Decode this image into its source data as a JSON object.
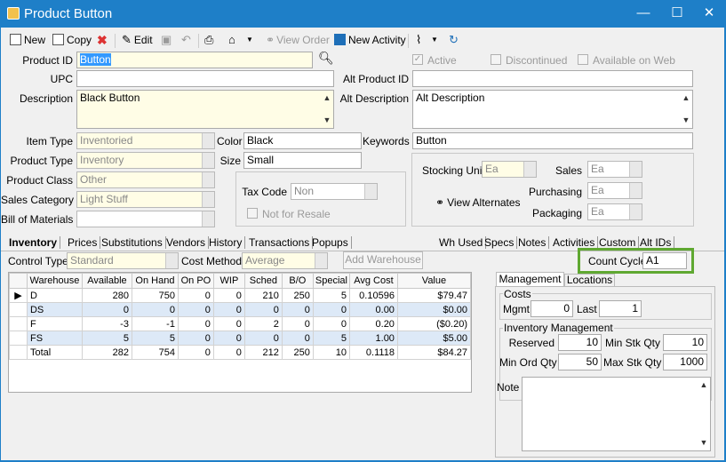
{
  "window": {
    "title": "Product Button",
    "minimize": "—",
    "maximize": "☐",
    "close": "✕"
  },
  "toolbar": {
    "new": "New",
    "copy": "Copy",
    "edit": "Edit",
    "view_order": "View Order",
    "new_activity": "New Activity"
  },
  "form": {
    "product_id_label": "Product ID",
    "product_id": "Button",
    "upc_label": "UPC",
    "upc": "",
    "description_label": "Description",
    "description": "Black Button",
    "alt_product_id_label": "Alt Product ID",
    "alt_product_id": "",
    "alt_description_label": "Alt Description",
    "alt_description": "Alt Description",
    "active_label": "Active",
    "discontinued_label": "Discontinued",
    "available_on_web_label": "Available on Web",
    "item_type_label": "Item Type",
    "item_type": "Inventoried",
    "product_type_label": "Product Type",
    "product_type": "Inventory",
    "product_class_label": "Product Class",
    "product_class": "Other",
    "sales_category_label": "Sales Category",
    "sales_category": "Light Stuff",
    "bill_of_materials_label": "Bill of Materials",
    "bill_of_materials": "",
    "color_label": "Color",
    "color": "Black",
    "size_label": "Size",
    "size": "Small",
    "keywords_label": "Keywords",
    "keywords": "Button",
    "tax_code_label": "Tax Code",
    "tax_code": "Non",
    "not_for_resale_label": "Not for Resale",
    "stocking_unit_label": "Stocking Unit",
    "stocking_unit": "Ea",
    "view_alternates": "View Alternates",
    "sales_label": "Sales",
    "sales_unit": "Ea",
    "purchasing_label": "Purchasing",
    "purchasing_unit": "Ea",
    "packaging_label": "Packaging",
    "packaging_unit": "Ea"
  },
  "tabs_left": [
    "Inventory",
    "Prices",
    "Substitutions",
    "Vendors",
    "History",
    "Transactions",
    "Popups"
  ],
  "tabs_right": [
    "Wh Used",
    "Specs",
    "Notes",
    "Activities",
    "Custom",
    "Alt IDs"
  ],
  "inventory": {
    "control_type_label": "Control Type",
    "control_type": "Standard",
    "cost_method_label": "Cost Method",
    "cost_method": "Average",
    "add_warehouse": "Add Warehouse",
    "count_cycle_label": "Count Cycle",
    "count_cycle": "A1",
    "columns": [
      "Warehouse",
      "Available",
      "On Hand",
      "On PO",
      "WIP",
      "Sched",
      "B/O",
      "Special",
      "Avg Cost",
      "Value"
    ],
    "rows": [
      [
        "D",
        "280",
        "750",
        "0",
        "0",
        "210",
        "250",
        "5",
        "0.10596",
        "$79.47"
      ],
      [
        "DS",
        "0",
        "0",
        "0",
        "0",
        "0",
        "0",
        "0",
        "0.00",
        "$0.00"
      ],
      [
        "F",
        "-3",
        "-1",
        "0",
        "0",
        "2",
        "0",
        "0",
        "0.20",
        "($0.20)"
      ],
      [
        "FS",
        "5",
        "5",
        "0",
        "0",
        "0",
        "0",
        "5",
        "1.00",
        "$5.00"
      ],
      [
        "Total",
        "282",
        "754",
        "0",
        "0",
        "212",
        "250",
        "10",
        "0.1118",
        "$84.27"
      ]
    ]
  },
  "management": {
    "tab_management": "Management",
    "tab_locations": "Locations",
    "costs_label": "Costs",
    "mgmt_label": "Mgmt",
    "mgmt": "0",
    "last_label": "Last",
    "last": "1",
    "inv_mgmt_label": "Inventory Management",
    "reserved_label": "Reserved",
    "reserved": "10",
    "min_stk_qty_label": "Min Stk Qty",
    "min_stk_qty": "10",
    "min_ord_qty_label": "Min Ord Qty",
    "min_ord_qty": "50",
    "max_stk_qty_label": "Max Stk Qty",
    "max_stk_qty": "1000",
    "note_label": "Note",
    "note": ""
  },
  "colors": {
    "titlebar": "#1e7fc8",
    "highlight": "#5fa831",
    "readonly_bg": "#fffde6"
  }
}
